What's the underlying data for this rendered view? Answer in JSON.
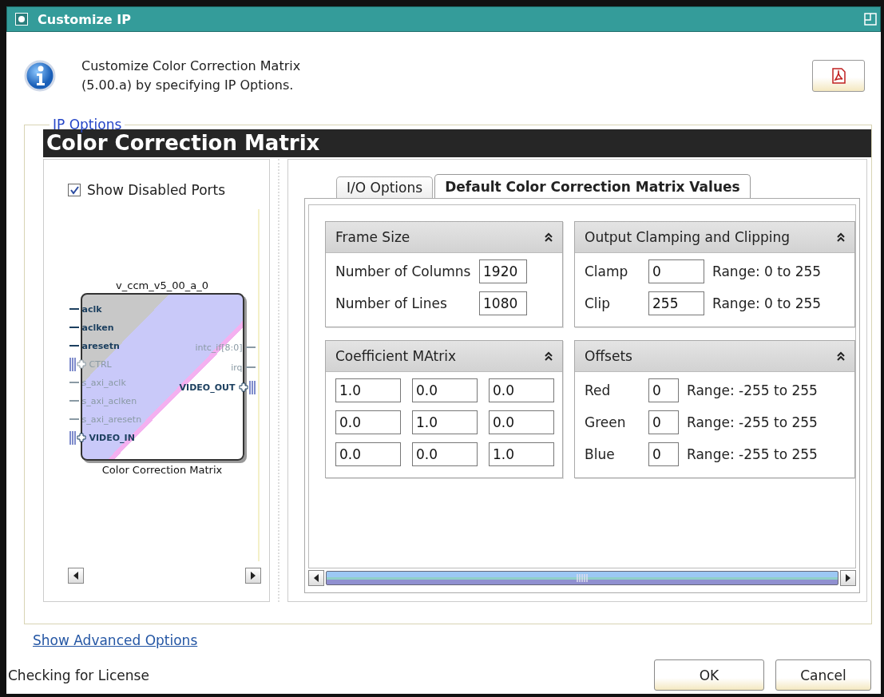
{
  "window": {
    "title": "Customize IP"
  },
  "header": {
    "description_lines": [
      "Customize Color Correction Matrix",
      "(5.00.a) by specifying IP Options."
    ]
  },
  "ip_options": {
    "legend": "IP Options",
    "banner": "Color Correction Matrix",
    "symbol_panel": {
      "show_disabled_ports": {
        "label": "Show Disabled Ports",
        "checked": true
      },
      "symbol": {
        "instance": "v_ccm_v5_00_a_0",
        "caption": "Color Correction Matrix",
        "left_ports": [
          {
            "name": "aclk",
            "kind": "wire",
            "enabled": true
          },
          {
            "name": "aclken",
            "kind": "wire",
            "enabled": true
          },
          {
            "name": "aresetn",
            "kind": "wire",
            "enabled": true
          },
          {
            "name": "CTRL",
            "kind": "bus",
            "enabled": false
          },
          {
            "name": "s_axi_aclk",
            "kind": "wire",
            "enabled": false
          },
          {
            "name": "s_axi_aclken",
            "kind": "wire",
            "enabled": false
          },
          {
            "name": "s_axi_aresetn",
            "kind": "wire",
            "enabled": false
          },
          {
            "name": "VIDEO_IN",
            "kind": "bus",
            "enabled": true
          }
        ],
        "right_ports": [
          {
            "name": "intc_if[8:0]",
            "kind": "wire",
            "enabled": false
          },
          {
            "name": "irq",
            "kind": "wire",
            "enabled": false
          },
          {
            "name": "VIDEO_OUT",
            "kind": "bus",
            "enabled": true
          }
        ]
      }
    },
    "tabs": [
      {
        "label": "I/O Options",
        "selected": false
      },
      {
        "label": "Default Color Correction Matrix Values",
        "selected": true
      }
    ],
    "sections": [
      {
        "kind": "fields",
        "title": "Frame Size",
        "rows": [
          {
            "label": "Number of Columns",
            "value": "1920"
          },
          {
            "label": "Number of Lines",
            "value": "1080"
          }
        ]
      },
      {
        "kind": "fields",
        "title": "Output Clamping and Clipping",
        "rows": [
          {
            "label": "Clamp",
            "value": "0",
            "range": "Range: 0 to 255"
          },
          {
            "label": "Clip",
            "value": "255",
            "range": "Range: 0 to 255"
          }
        ]
      },
      {
        "kind": "matrix",
        "title": "Coefficient MAtrix",
        "rows": [
          [
            "1.0",
            "0.0",
            "0.0"
          ],
          [
            "0.0",
            "1.0",
            "0.0"
          ],
          [
            "0.0",
            "0.0",
            "1.0"
          ]
        ]
      },
      {
        "kind": "fields",
        "title": "Offsets",
        "rows": [
          {
            "label": "Red",
            "value": "0",
            "range": "Range: -255 to 255"
          },
          {
            "label": "Green",
            "value": "0",
            "range": "Range: -255 to 255"
          },
          {
            "label": "Blue",
            "value": "0",
            "range": "Range: -255 to 255"
          }
        ]
      }
    ]
  },
  "footer": {
    "link": "Show Advanced Options",
    "status": "Checking for License",
    "buttons": [
      "OK",
      "Cancel"
    ]
  }
}
